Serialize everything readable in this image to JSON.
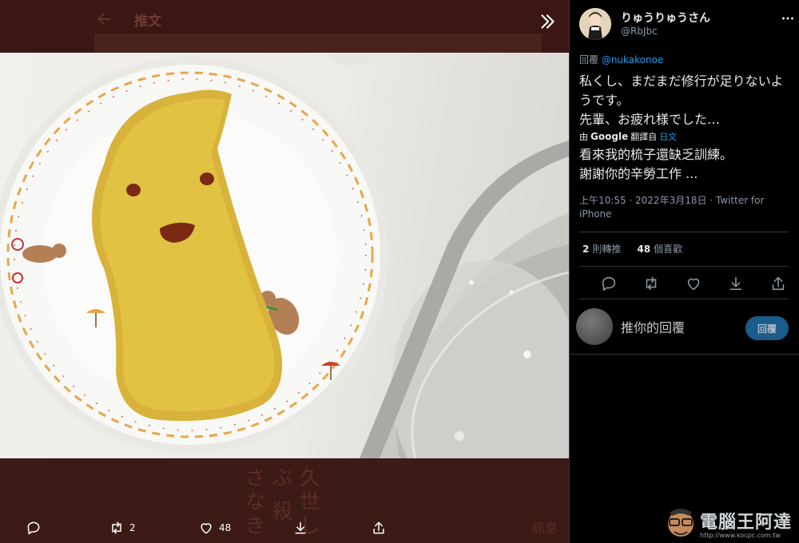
{
  "viewer": {
    "title": "推文",
    "ghost_vertical": "久世しぶ\n殺さなき",
    "ghost_side": "訊息",
    "actions": {
      "reply_count": "",
      "retweet_count": "2",
      "like_count": "48"
    }
  },
  "tweet": {
    "display_name": "りゅうりゅうさん",
    "handle": "@RbJbc",
    "reply_prefix": "回覆 ",
    "reply_to": "@nukakonoe",
    "original_text": "私くし、まだまだ修行が足りないようです。\n先輩、お疲れ様でした…",
    "translate_prefix": "由",
    "translate_service": "Google",
    "translate_mid": "翻譯自",
    "translate_lang": "日文",
    "translated_text": "看來我的梳子還缺乏訓練。\n謝謝你的辛勞工作 ...",
    "timestamp": "上午10:55 · 2022年3月18日 · Twitter for iPhone",
    "retweets_num": "2",
    "retweets_label": "則轉推",
    "likes_num": "48",
    "likes_label": "個喜歡"
  },
  "reply": {
    "placeholder": "推你的回覆",
    "button": "回覆"
  },
  "watermark": {
    "text": "電腦王阿達",
    "url": "http://www.kocpc.com.tw"
  },
  "colors": {
    "accent": "#1d9bf0",
    "viewer_bg": "#3b1814",
    "panel_bg": "#000000"
  }
}
